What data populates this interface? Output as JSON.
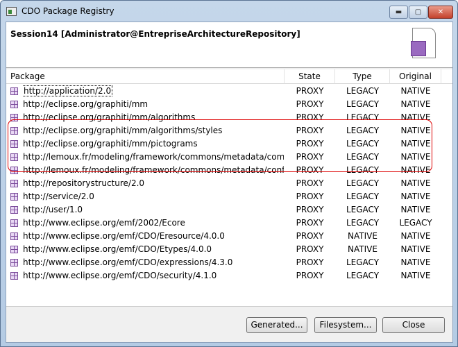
{
  "window": {
    "title": "CDO Package Registry",
    "min": "▬",
    "max": "▢",
    "close": "✕"
  },
  "header": {
    "session": "Session14 [Administrator@EntrepriseArchitectureRepository]"
  },
  "table": {
    "columns": [
      "Package",
      "State",
      "Type",
      "Original"
    ],
    "rows": [
      [
        "http://application/2.0",
        "PROXY",
        "LEGACY",
        "NATIVE"
      ],
      [
        "http://eclipse.org/graphiti/mm",
        "PROXY",
        "LEGACY",
        "NATIVE"
      ],
      [
        "http://eclipse.org/graphiti/mm/algorithms",
        "PROXY",
        "LEGACY",
        "NATIVE"
      ],
      [
        "http://eclipse.org/graphiti/mm/algorithms/styles",
        "PROXY",
        "LEGACY",
        "NATIVE"
      ],
      [
        "http://eclipse.org/graphiti/mm/pictograms",
        "PROXY",
        "LEGACY",
        "NATIVE"
      ],
      [
        "http://lemoux.fr/modeling/framework/commons/metadata/commit",
        "PROXY",
        "LEGACY",
        "NATIVE"
      ],
      [
        "http://lemoux.fr/modeling/framework/commons/metadata/configu...",
        "PROXY",
        "LEGACY",
        "NATIVE"
      ],
      [
        "http://repositorystructure/2.0",
        "PROXY",
        "LEGACY",
        "NATIVE"
      ],
      [
        "http://service/2.0",
        "PROXY",
        "LEGACY",
        "NATIVE"
      ],
      [
        "http://user/1.0",
        "PROXY",
        "LEGACY",
        "NATIVE"
      ],
      [
        "http://www.eclipse.org/emf/2002/Ecore",
        "PROXY",
        "LEGACY",
        "LEGACY"
      ],
      [
        "http://www.eclipse.org/emf/CDO/Eresource/4.0.0",
        "PROXY",
        "NATIVE",
        "NATIVE"
      ],
      [
        "http://www.eclipse.org/emf/CDO/Etypes/4.0.0",
        "PROXY",
        "NATIVE",
        "NATIVE"
      ],
      [
        "http://www.eclipse.org/emf/CDO/expressions/4.3.0",
        "PROXY",
        "LEGACY",
        "NATIVE"
      ],
      [
        "http://www.eclipse.org/emf/CDO/security/4.1.0",
        "PROXY",
        "LEGACY",
        "NATIVE"
      ]
    ]
  },
  "buttons": {
    "generated": "Generated...",
    "filesystem": "Filesystem...",
    "close": "Close"
  }
}
